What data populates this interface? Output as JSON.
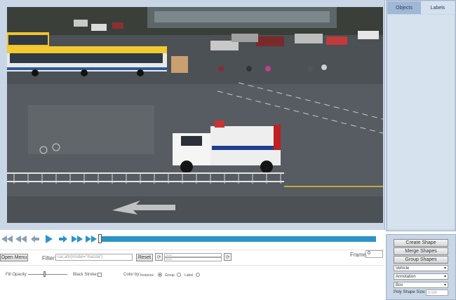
{
  "sidebar": {
    "tabs": [
      {
        "label": "Objects",
        "active": true
      },
      {
        "label": "Labels",
        "active": false
      }
    ]
  },
  "playback": {
    "buttons": [
      "skip-back",
      "step-back-fast",
      "step-back",
      "play",
      "step-forward",
      "step-forward-fast",
      "skip-forward"
    ],
    "accent": "#2c93c7"
  },
  "controls": {
    "open_menu_label": "Open Menu",
    "filter_label": "Filter:",
    "filter_placeholder": "car,attr(model=\"mazda\")",
    "reset_label": "Reset",
    "range_from_placeholder": "from",
    "range_to_placeholder": "from",
    "frame_label": "Frame",
    "frame_value": "0"
  },
  "display": {
    "fill_opacity_label": "Fill Opacity:",
    "black_stroke_label": "Black Stroke:",
    "color_by_label": "Color by:",
    "color_options": [
      {
        "label": "Instance",
        "selected": true
      },
      {
        "label": "Group",
        "selected": false
      },
      {
        "label": "Label",
        "selected": false
      }
    ]
  },
  "panel": {
    "create_shape": "Create Shape",
    "merge_shapes": "Merge Shapes",
    "group_shapes": "Group Shapes",
    "label_select": "Vehicle",
    "mode_select": "Annotation",
    "shape_select": "Box",
    "poly_size_label": "Poly Shape Size:",
    "poly_size_placeholder": "3-100"
  }
}
